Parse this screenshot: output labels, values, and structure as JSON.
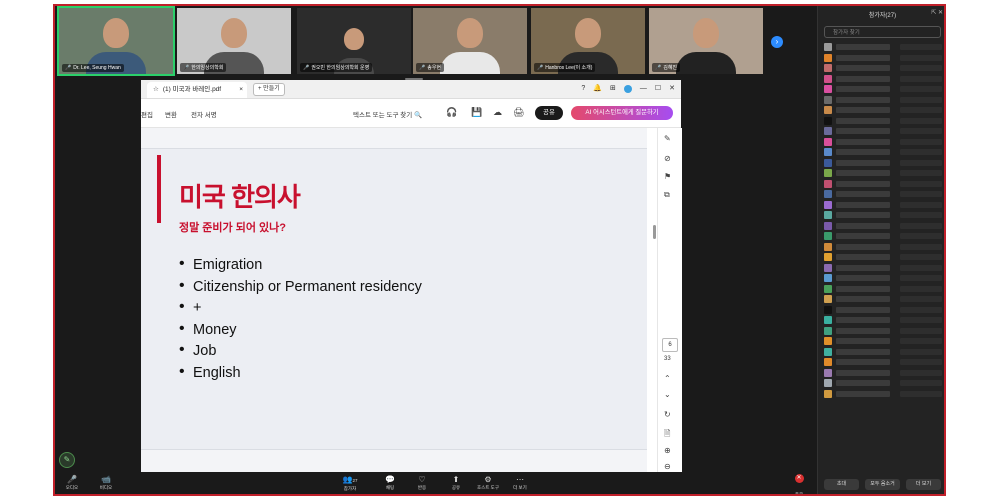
{
  "participants": [
    {
      "name": "Dr. Lee, Seung Hwan",
      "color": "#6a7c6a",
      "active": true
    },
    {
      "name": "한의임상의학회",
      "color": "#c9c9c9",
      "active": false
    },
    {
      "name": "권오빈 한의임상의학회 운영",
      "color": "#2c2c2c",
      "active": false
    },
    {
      "name": "송우현",
      "color": "#8a7c6a",
      "active": false
    },
    {
      "name": "Hanbros Lee(이 소개)",
      "color": "#7a6a50",
      "active": false
    },
    {
      "name": "김혜진",
      "color": "#b0a090",
      "active": false
    }
  ],
  "panel": {
    "title": "참가자(27)",
    "search_placeholder": "참가자 찾기",
    "buttons": [
      "초대",
      "모두 음소거",
      "더 보기"
    ],
    "avatar_colors": [
      "#9a9a9a",
      "#e0832a",
      "#c06b6b",
      "#d0508a",
      "#d94fa0",
      "#6a6a6a",
      "#c88a4a",
      "#111111",
      "#6a6a9a",
      "#d94f9a",
      "#5a8acb",
      "#3b5a9a",
      "#7aa84a",
      "#c05070",
      "#4a6aa0",
      "#9a6ad0",
      "#5aa8a0",
      "#7a5aaa",
      "#3a9a6a",
      "#d08a3a",
      "#e0a030",
      "#8a6ab0",
      "#5a9ad0",
      "#4aa05a",
      "#d0a050",
      "#111111",
      "#3ab0a0",
      "#40a080",
      "#e0902a",
      "#40b0a0",
      "#e08a2a",
      "#9a7ab0",
      "#a0a8b0",
      "#d09a40"
    ]
  },
  "pdf": {
    "tab_title": "(1) 미국과 바레인.pdf",
    "new_tab_label": "+ 만들기",
    "menu": [
      "편집",
      "변환",
      "전자 서명"
    ],
    "find_label": "텍스트 또는 도구 찾기",
    "share_label": "공유",
    "ai_label": "AI 어시스턴트에게 질문하기",
    "page_current": "6",
    "page_total": "33"
  },
  "slide": {
    "title": "미국 한의사",
    "subtitle": "정말 준비가 되어 있나?",
    "bullets": [
      "Emigration",
      "Citizenship or Permanent residency",
      "+",
      "Money",
      "Job",
      "English"
    ]
  },
  "toolbar": {
    "items": [
      {
        "icon": "🎤",
        "label": "오디오"
      },
      {
        "icon": "📹",
        "label": "비디오"
      },
      {
        "icon": "👥",
        "label": "참가자"
      },
      {
        "icon": "💬",
        "label": "채팅"
      },
      {
        "icon": "♡",
        "label": "반응"
      },
      {
        "icon": "⬆",
        "label": "공유"
      },
      {
        "icon": "⚙",
        "label": "호스트 도구"
      },
      {
        "icon": "⋯",
        "label": "더 보기"
      }
    ],
    "participant_count": "27",
    "end_label": "종료"
  }
}
